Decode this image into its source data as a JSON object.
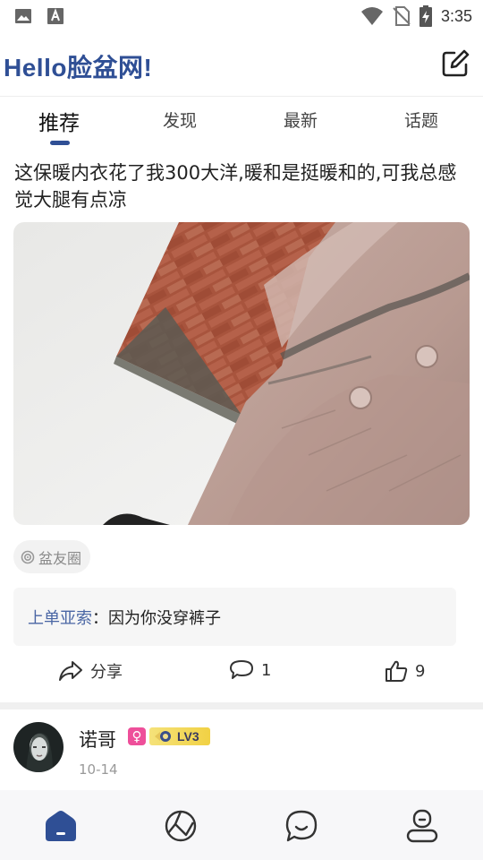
{
  "status_bar": {
    "time": "3:35",
    "icons": [
      "image-notification-icon",
      "text-notification-icon",
      "wifi-icon",
      "no-sim-icon",
      "battery-charging-icon"
    ]
  },
  "header": {
    "title": "Hello脸盆网!",
    "edit_icon": "edit-icon"
  },
  "tabs": [
    {
      "label": "推荐",
      "active": true
    },
    {
      "label": "发现",
      "active": false
    },
    {
      "label": "最新",
      "active": false
    },
    {
      "label": "话题",
      "active": false
    }
  ],
  "post": {
    "title": "这保暖内衣花了我300大洋,暖和是挺暖和的,可我总感觉大腿有点凉",
    "circle_tag": "盆友圈",
    "comment": {
      "user": "上单亚索",
      "separator": "：",
      "text": "因为你没穿裤子"
    },
    "actions": {
      "share_label": "分享",
      "comment_count": "1",
      "like_count": "9"
    }
  },
  "next_post": {
    "user_name": "诺哥",
    "gender_symbol": "♀",
    "level": "LV3",
    "date": "10-14"
  },
  "bottom_nav": {
    "items": [
      "home-icon",
      "circle-icon",
      "message-icon",
      "profile-icon"
    ],
    "active_index": 0
  },
  "colors": {
    "brand": "#2f4f95",
    "comment_user": "#4a66a4",
    "gender_female": "#ee4f9a"
  }
}
